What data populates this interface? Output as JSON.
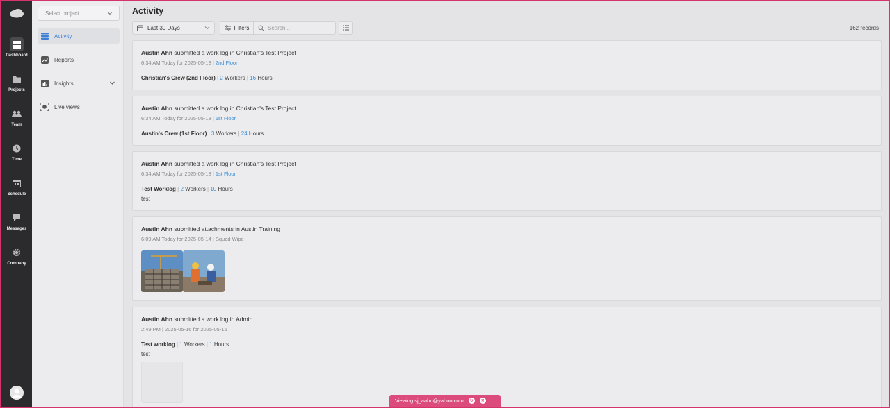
{
  "rail": {
    "items": [
      {
        "label": "Dashboard",
        "icon": "dashboard-icon"
      },
      {
        "label": "Projects",
        "icon": "folder-icon"
      },
      {
        "label": "Team",
        "icon": "team-icon"
      },
      {
        "label": "Time",
        "icon": "clock-icon"
      },
      {
        "label": "Schedule",
        "icon": "calendar-icon"
      },
      {
        "label": "Messages",
        "icon": "chat-icon"
      },
      {
        "label": "Company",
        "icon": "gear-icon"
      }
    ]
  },
  "sidebar": {
    "project_placeholder": "Select project",
    "items": [
      {
        "label": "Activity",
        "icon": "activity-icon"
      },
      {
        "label": "Reports",
        "icon": "chart-icon"
      },
      {
        "label": "Insights",
        "icon": "bar-chart-icon"
      },
      {
        "label": "Live views",
        "icon": "live-view-icon"
      }
    ]
  },
  "header": {
    "title": "Activity",
    "date_range": "Last 30 Days",
    "filters_label": "Filters",
    "search_placeholder": "Search...",
    "records": "162 records"
  },
  "activity": [
    {
      "user": "Austin Ahn",
      "action": " submitted a work log in Christian's Test Project",
      "meta": "6:34 AM Today for 2025-05-18 | ",
      "location": "2nd Floor",
      "crew": "Christian's Crew (2nd Floor)",
      "workers": "2",
      "workers_label": " Workers ",
      "hours": "16",
      "hours_label": " Hours"
    },
    {
      "user": "Austin Ahn",
      "action": " submitted a work log in Christian's Test Project",
      "meta": "6:34 AM Today for 2025-05-18 | ",
      "location": "1st Floor",
      "crew": "Austin's Crew (1st Floor)",
      "workers": "3",
      "workers_label": " Workers ",
      "hours": "24",
      "hours_label": " Hours"
    },
    {
      "user": "Austin Ahn",
      "action": " submitted a work log in Christian's Test Project",
      "meta": "6:34 AM Today for 2025-05-18 | ",
      "location": "1st Floor",
      "crew": "Test Worklog",
      "workers": "2",
      "workers_label": " Workers ",
      "hours": "10",
      "hours_label": " Hours",
      "note": "test"
    },
    {
      "user": "Austin Ahn",
      "action": " submitted attachments in Austin Training",
      "meta": "6:09 AM Today for 2025-05-14 | Squad Wipe"
    },
    {
      "user": "Austin Ahn",
      "action": " submitted a work log in Admin",
      "meta": "2:49 PM | 2025-05-16 for 2025-05-16",
      "crew": "Test worklog",
      "workers": "1",
      "workers_label": " Workers ",
      "hours": "1",
      "hours_label": " Hours",
      "note": "test"
    }
  ],
  "banner": {
    "text": "Viewing sj_aahn@yahoo.com"
  },
  "colors": {
    "accent": "#3d8fd6",
    "banner": "#db4c7d",
    "rail": "#2b2b2d"
  }
}
